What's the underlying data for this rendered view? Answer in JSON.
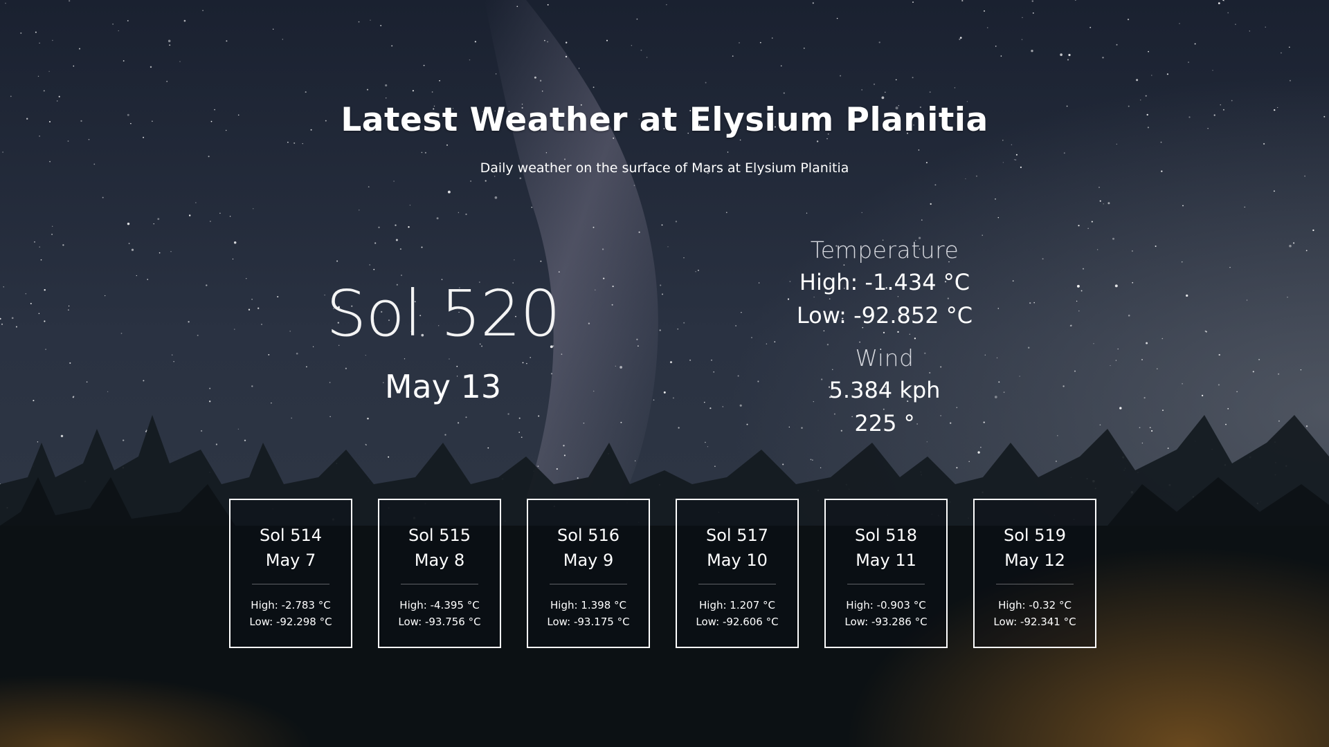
{
  "header": {
    "title": "Latest Weather at Elysium Planitia",
    "subtitle": "Daily weather on the surface of Mars at Elysium Planitia"
  },
  "current": {
    "sol": "Sol 520",
    "date": "May 13",
    "temperature_label": "Temperature",
    "high": "High: -1.434 °C",
    "low": "Low: -92.852 °C",
    "wind_label": "Wind",
    "wind_speed": "5.384 kph",
    "wind_direction": "225 °"
  },
  "previous_sols": [
    {
      "sol": "Sol 514",
      "date": "May 7",
      "high": "High: -2.783 °C",
      "low": "Low: -92.298 °C"
    },
    {
      "sol": "Sol 515",
      "date": "May 8",
      "high": "High: -4.395 °C",
      "low": "Low: -93.756 °C"
    },
    {
      "sol": "Sol 516",
      "date": "May 9",
      "high": "High: 1.398 °C",
      "low": "Low: -93.175 °C"
    },
    {
      "sol": "Sol 517",
      "date": "May 10",
      "high": "High: 1.207 °C",
      "low": "Low: -92.606 °C"
    },
    {
      "sol": "Sol 518",
      "date": "May 11",
      "high": "High: -0.903 °C",
      "low": "Low: -93.286 °C"
    },
    {
      "sol": "Sol 519",
      "date": "May 12",
      "high": "High: -0.32 °C",
      "low": "Low: -92.341 °C"
    }
  ],
  "colors": {
    "sky_top": "#1e2533",
    "sky_mid": "#2c3443",
    "forest": "#0f1519",
    "foliage": "#6b4a1c",
    "text": "#ffffff"
  }
}
